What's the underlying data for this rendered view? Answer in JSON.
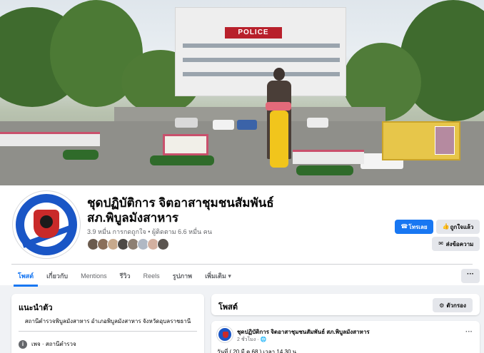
{
  "cover": {
    "police_sign": "POLICE"
  },
  "profile": {
    "name_line1": "ชุดปฏิบัติการ จิตอาสาชุมชนสัมพันธ์",
    "name_line2": "สภ.พิบูลมังสาหาร",
    "stats": "3.9 หมื่น การกดถูกใจ • ผู้ติดตาม 6.6 หมื่น คน",
    "friend_colors": [
      "#6b5b4e",
      "#8a6f5a",
      "#c7a98c",
      "#4e4a46",
      "#8d7f72",
      "#b0b8c4",
      "#d3b0a0",
      "#5b5550"
    ]
  },
  "actions": {
    "call": "โทรเลย",
    "like": "ถูกใจแล้ว",
    "message": "ส่งข้อความ"
  },
  "tabs": [
    "โพสต์",
    "เกี่ยวกับ",
    "Mentions",
    "รีวิว",
    "Reels",
    "รูปภาพ",
    "เพิ่มเติม"
  ],
  "more_button": "···",
  "intro": {
    "title": "แนะนำตัว",
    "description": "สถานีตำรวจพิบูลมังสาหาร อำเภอพิบูลมังสาหาร จังหวัดอุบลราชธานี",
    "category_label": "เพจ · สถานีตำรวจ"
  },
  "posts": {
    "title": "โพสต์",
    "filter": "ตัวกรอง",
    "post": {
      "author": "ชุดปฏิบัติการ จิตอาสาชุมชนสัมพันธ์ สภ.พิบูลมังสาหาร",
      "time": "2 ชั่วโมง · ",
      "menu": "···",
      "body": "วันที่ ( 20 มี.ค.68 ) เวลา 14.30 น."
    }
  },
  "colors": {
    "accent": "#1877f2",
    "page_bg": "#f0f2f5"
  }
}
